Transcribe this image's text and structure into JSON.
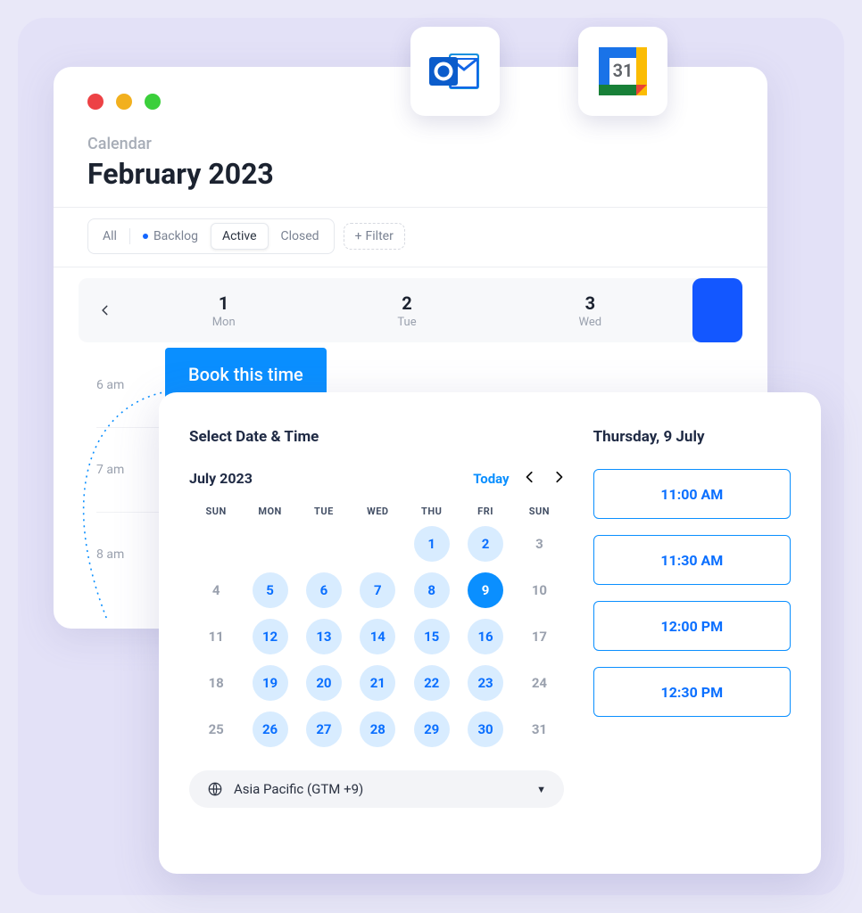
{
  "header": {
    "eyebrow": "Calendar",
    "title": "February 2023"
  },
  "tabs": {
    "all": "All",
    "backlog": "Backlog",
    "active": "Active",
    "closed": "Closed",
    "filter": "Filter"
  },
  "week": {
    "days": [
      {
        "num": "1",
        "label": "Mon"
      },
      {
        "num": "2",
        "label": "Tue"
      },
      {
        "num": "3",
        "label": "Wed"
      }
    ]
  },
  "timeslots": [
    "6 am",
    "7 am",
    "8 am"
  ],
  "book_button": "Book this time",
  "picker": {
    "title": "Select Date & Time",
    "month": "July 2023",
    "today": "Today",
    "dow": [
      "SUN",
      "MON",
      "TUE",
      "WED",
      "THU",
      "FRI",
      "SUN"
    ],
    "grid": [
      [
        "",
        "",
        "",
        "",
        "1",
        "2",
        "3"
      ],
      [
        "4",
        "5",
        "6",
        "7",
        "8",
        "9",
        "10"
      ],
      [
        "11",
        "12",
        "13",
        "14",
        "15",
        "16",
        "17"
      ],
      [
        "18",
        "19",
        "20",
        "21",
        "22",
        "23",
        "24"
      ],
      [
        "25",
        "26",
        "27",
        "28",
        "29",
        "30",
        "31"
      ]
    ],
    "available_cols": [
      1,
      2,
      3,
      4,
      5
    ],
    "selected": "9",
    "timezone": "Asia Pacific (GTM +9)",
    "selected_date_label": "Thursday, 9 July",
    "slots": [
      "11:00 AM",
      "11:30 AM",
      "12:00 PM",
      "12:30 PM"
    ]
  },
  "integrations": {
    "outlook": "Outlook",
    "gcal_day": "31"
  }
}
